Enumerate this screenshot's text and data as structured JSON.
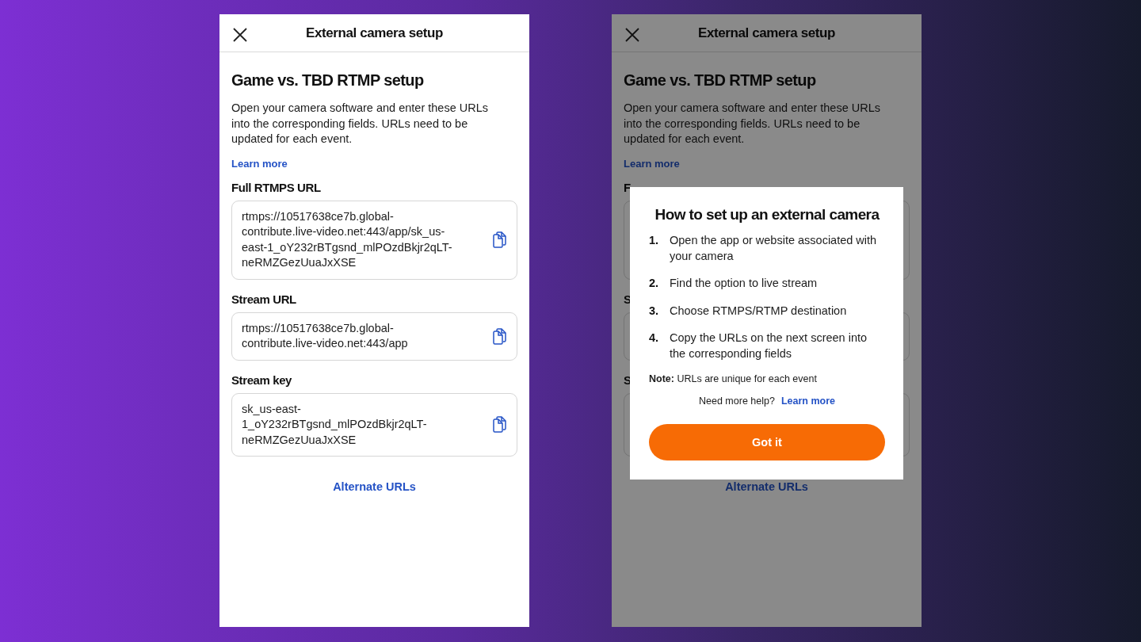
{
  "screens": [
    {
      "title": "External camera setup",
      "heading": "Game vs. TBD RTMP setup",
      "description": "Open your camera software and enter these URLs into the corresponding fields. URLs need to be updated for each event.",
      "learn_more": "Learn more",
      "fields": [
        {
          "label": "Full RTMPS URL",
          "value": "rtmps://10517638ce7b.global-contribute.live-video.net:443/app/sk_us-east-1_oY232rBTgsnd_mlPOzdBkjr2qLT-neRMZGezUuaJxXSE"
        },
        {
          "label": "Stream URL",
          "value": "rtmps://10517638ce7b.global-contribute.live-video.net:443/app"
        },
        {
          "label": "Stream key",
          "value": "sk_us-east-1_oY232rBTgsnd_mlPOzdBkjr2qLT-neRMZGezUuaJxXSE"
        }
      ],
      "alternate_link": "Alternate URLs"
    },
    {
      "title": "External camera setup",
      "heading": "Game vs. TBD RTMP setup",
      "description": "Open your camera software and enter these URLs into the corresponding fields. URLs need to be updated for each event.",
      "learn_more": "Learn more",
      "fields": [
        {
          "label": "F"
        },
        {
          "label": "S"
        },
        {
          "label": "S"
        }
      ],
      "alternate_link": "Alternate URLs",
      "dialog": {
        "title": "How to set up an external camera",
        "steps": [
          {
            "number": "1.",
            "text": "Open the app or website associated with your camera"
          },
          {
            "number": "2.",
            "text": "Find the option to live stream"
          },
          {
            "number": "3.",
            "text": "Choose RTMPS/RTMP destination"
          },
          {
            "number": "4.",
            "text": "Copy the URLs on the next screen into the corresponding fields"
          }
        ],
        "note": "**Note:** URLs are unique for each event",
        "help_text": "Need more help?",
        "help_link": "Learn more",
        "button": "Got it"
      }
    }
  ]
}
